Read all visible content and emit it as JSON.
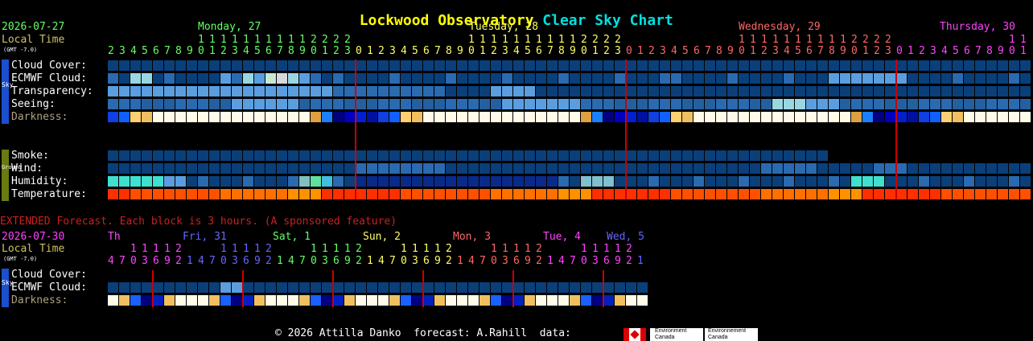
{
  "title": {
    "main": "Lockwood Observatory",
    "sub": "Clear Sky Chart",
    "main_color": "#ffff00",
    "sub_color": "#00e0e0"
  },
  "header": {
    "date": "2026-07-27",
    "local_time": "Local Time",
    "gmt": "(GMT -7.0)",
    "days": [
      {
        "label": "Monday, 27",
        "color": "#66ff66"
      },
      {
        "label": "Tuesday, 28",
        "color": "#ffff66"
      },
      {
        "label": "Wednesday, 29",
        "color": "#ff6666"
      },
      {
        "label": "Thursday, 30",
        "color": "#ff44ff"
      }
    ],
    "tens_row": "11111111111112222      11111111111112222      11111111111112222      11",
    "hours_row": "2345678901234567890123012345678901234567890123012345678901234567890123012345678901"
  },
  "sky_rows": [
    {
      "label": "Cloud Cover:",
      "color": "#ffffff"
    },
    {
      "label": "ECMWF Cloud:",
      "color": "#ffffff"
    },
    {
      "label": "Transparency:",
      "color": "#ffffff"
    },
    {
      "label": "Seeing:",
      "color": "#ffffff"
    },
    {
      "label": "Darkness:",
      "color": "#b0a080"
    }
  ],
  "ground_rows": [
    {
      "label": "Smoke:"
    },
    {
      "label": "Wind:"
    },
    {
      "label": "Humidity:"
    },
    {
      "label": "Temperature:"
    }
  ],
  "side_tabs": {
    "sky": "Sky",
    "ground": "Ground"
  },
  "extended": {
    "note": "EXTENDED Forecast. Each block is 3 hours. (A sponsored feature)",
    "date": "2026-07-30",
    "local_time": "Local Time",
    "gmt": "(GMT -7.0)",
    "days": [
      {
        "label": "Th",
        "color": "#ff44ff"
      },
      {
        "label": "Fri, 31",
        "color": "#6666ff"
      },
      {
        "label": "Sat, 1",
        "color": "#66ff66"
      },
      {
        "label": "Sun, 2",
        "color": "#ffff66"
      },
      {
        "label": "Mon, 3",
        "color": "#ff6666"
      },
      {
        "label": "Tue, 4",
        "color": "#ff44ff"
      },
      {
        "label": "Wed, 5",
        "color": "#6666ff"
      }
    ],
    "rows": [
      {
        "label": "Cloud Cover:"
      },
      {
        "label": "ECMWF Cloud:"
      },
      {
        "label": "Darkness:"
      }
    ]
  },
  "footer": {
    "text": "© 2026 Attilla Danko  forecast: A.Rahill  data:",
    "badge1": "Environment Canada",
    "badge2": "Environnement Canada"
  },
  "colors": {
    "dark_blue": "#0a3f7a",
    "mid_blue": "#2a6ab0",
    "light_blue": "#5a9ee0",
    "pale": "#bcdfe8",
    "red_line": "#cc0000"
  }
}
